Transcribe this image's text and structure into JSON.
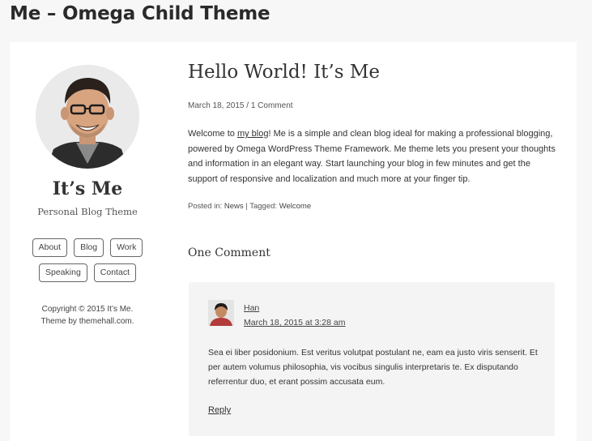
{
  "page_title": "Me – Omega Child Theme",
  "sidebar": {
    "site_title": "It’s Me",
    "site_description": "Personal Blog Theme",
    "nav_items": [
      "About",
      "Blog",
      "Work",
      "Speaking",
      "Contact"
    ],
    "copyright_line1": "Copyright © 2015 It’s Me.",
    "copyright_line2": "Theme by themehall.com."
  },
  "post": {
    "title": "Hello World! It’s Me",
    "date": "March 18, 2015",
    "meta_separator": "/",
    "comment_count": "1 Comment",
    "excerpt_before_link": "Welcome to ",
    "excerpt_link": "my blog",
    "excerpt_after_link": "! Me is a simple and clean blog ideal for making a professional blogging, powered by Omega WordPress Theme Framework. Me theme lets you present your thoughts and information in an elegant way. Start launching your blog in few minutes and get the support of responsive and localization and much more at your finger tip.",
    "posted_in_label": "Posted in:",
    "category": "News",
    "tagged_label": "Tagged:",
    "tag": "Welcome"
  },
  "comments": {
    "title": "One Comment",
    "items": [
      {
        "author": "Han",
        "date": "March 18, 2015 at 3:28 am",
        "text": "Sea ei liber posidonium. Est veritus volutpat postulant ne, eam ea justo viris senserit. Et per autem volumus philosophia, vis vocibus singulis interpretaris te. Ex disputando referrentur duo, et erant possim accusata eum.",
        "reply_label": "Reply"
      }
    ]
  }
}
